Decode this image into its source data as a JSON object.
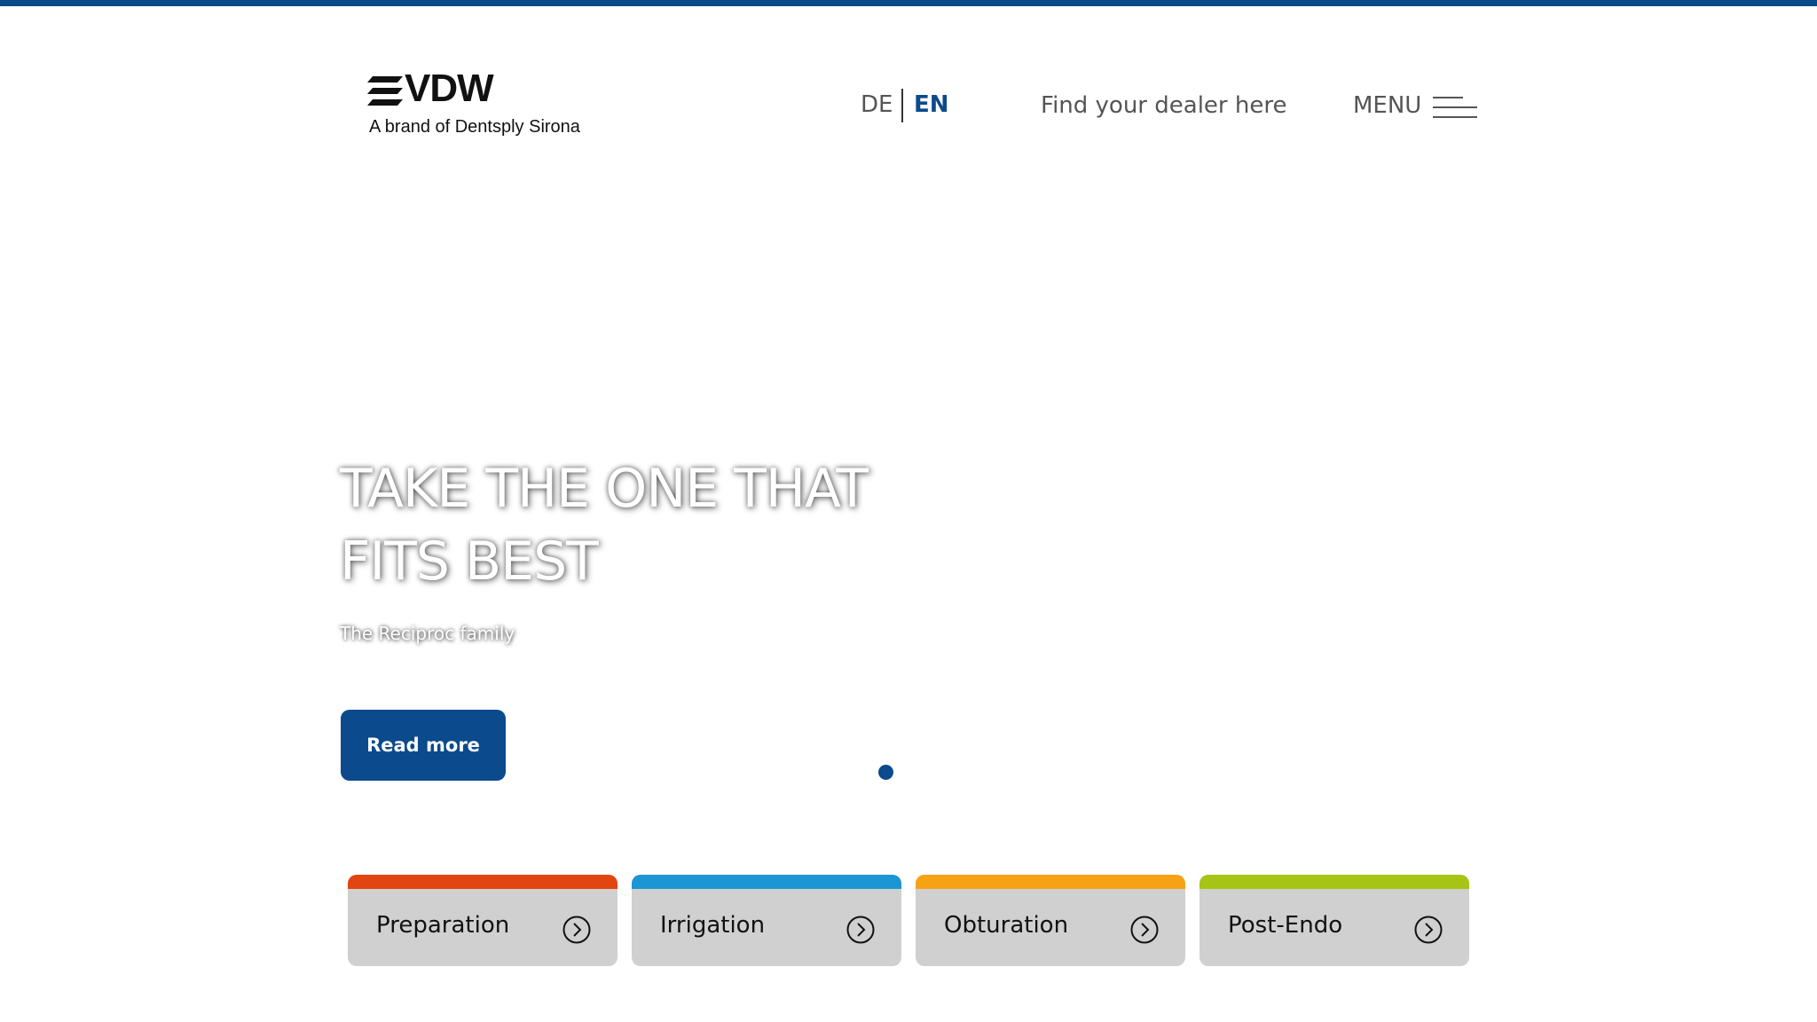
{
  "header": {
    "logo_text": "VDW",
    "logo_tagline": "A brand of Dentsply Sirona",
    "languages": [
      {
        "code": "DE",
        "active": false
      },
      {
        "code": "EN",
        "active": true
      }
    ],
    "dealer_link": "Find your dealer here",
    "menu_label": "MENU"
  },
  "hero": {
    "title_line1": "TAKE THE ONE THAT",
    "title_line2": "FITS BEST",
    "subtitle": "The Reciproc family",
    "cta_label": "Read more",
    "slide_count": 1,
    "active_slide": 1
  },
  "categories": [
    {
      "label": "Preparation",
      "color": "#e2450f",
      "icon": "chevron-right-circle-icon"
    },
    {
      "label": "Irrigation",
      "color": "#1a96d4",
      "icon": "chevron-right-circle-icon"
    },
    {
      "label": "Obturation",
      "color": "#f7a215",
      "icon": "chevron-right-circle-icon"
    },
    {
      "label": "Post-Endo",
      "color": "#a5c414",
      "icon": "chevron-right-circle-icon"
    }
  ],
  "colors": {
    "brand_blue": "#0b4a8c",
    "card_background": "#d0d0d0"
  }
}
